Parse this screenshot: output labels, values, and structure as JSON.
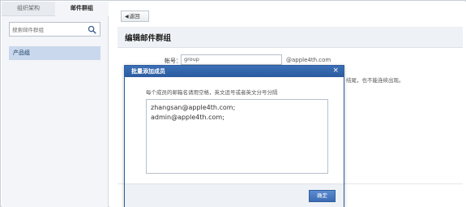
{
  "sidebar": {
    "tabs": [
      {
        "label": "组织架构"
      },
      {
        "label": "邮件群组"
      }
    ],
    "search_placeholder": "搜索邮件群组",
    "groups": [
      {
        "label": "产品组"
      }
    ]
  },
  "main": {
    "back_label": "返回",
    "page_title": "编辑邮件群组",
    "name_label": "帐号：",
    "name_value": "group",
    "name_suffix": "@apple4th.com",
    "hint": "结尾，也不能连续出现。"
  },
  "dialog": {
    "title": "批量添加成员",
    "close_glyph": "×",
    "instruction": "每个成员的邮箱名请用空格，英文逗号或者英文分号分隔",
    "members": [
      "zhangsan@apple4th.com;",
      "admin@apple4th.com;"
    ],
    "confirm_label": "确定"
  }
}
